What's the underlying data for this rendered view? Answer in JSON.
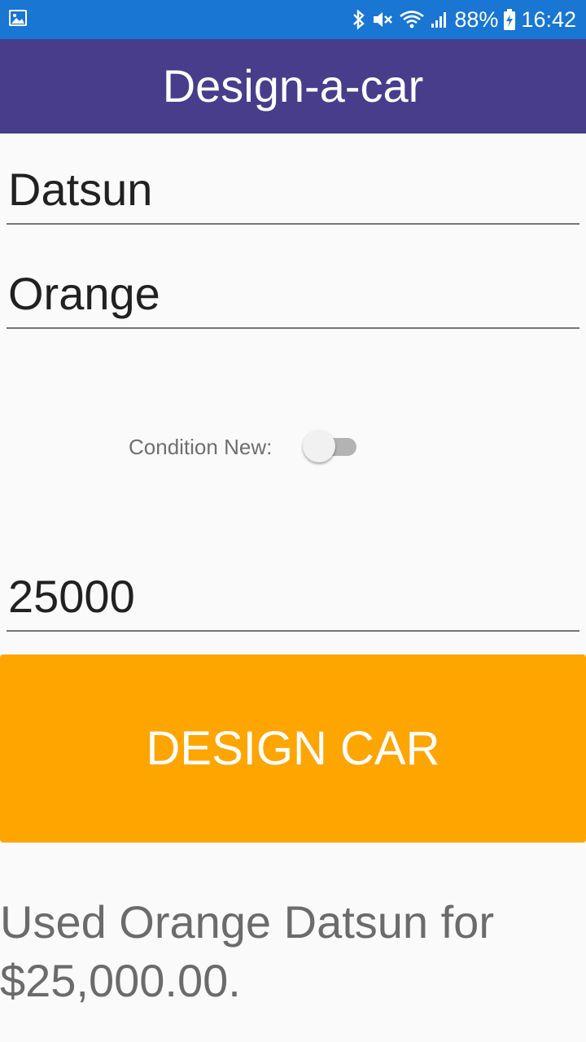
{
  "status_bar": {
    "battery": "88%",
    "time": "16:42",
    "icons": [
      "gallery-icon",
      "bluetooth-icon",
      "mute-icon",
      "wifi-icon",
      "signal-icon",
      "battery-icon"
    ]
  },
  "app_bar": {
    "title": "Design-a-car",
    "color": "#483d8b"
  },
  "form": {
    "make_value": "Datsun",
    "color_value": "Orange",
    "condition_label": "Condition New:",
    "condition_new": false,
    "price_value": "25000"
  },
  "button": {
    "label": "DESIGN CAR",
    "color": "#ffa500"
  },
  "result": {
    "text": "Used Orange Datsun for $25,000.00."
  }
}
